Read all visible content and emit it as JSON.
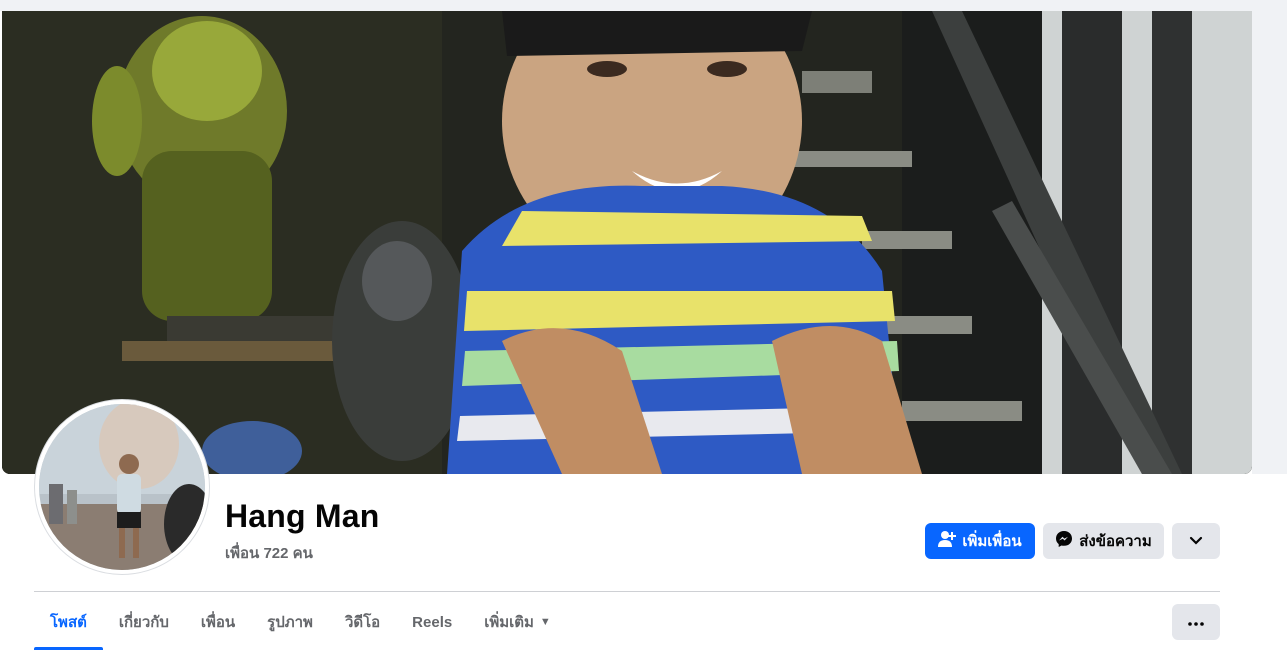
{
  "profile": {
    "name": "Hang Man",
    "friends_text": "เพื่อน 722 คน"
  },
  "actions": {
    "add_friend": "เพิ่มเพื่อน",
    "message": "ส่งข้อความ"
  },
  "tabs": [
    {
      "label": "โพสต์",
      "active": true
    },
    {
      "label": "เกี่ยวกับ"
    },
    {
      "label": "เพื่อน"
    },
    {
      "label": "รูปภาพ"
    },
    {
      "label": "วิดีโอ"
    },
    {
      "label": "Reels"
    },
    {
      "label": "เพิ่มเติม"
    }
  ],
  "colors": {
    "accent": "#0866ff",
    "button_gray": "#e4e6eb",
    "text_secondary": "#65676b"
  },
  "icons": {
    "add_friend": "person-plus-icon",
    "message": "messenger-icon",
    "more": "chevron-down-icon",
    "tab_more": "caret-down-icon",
    "overflow": "ellipsis-icon"
  }
}
